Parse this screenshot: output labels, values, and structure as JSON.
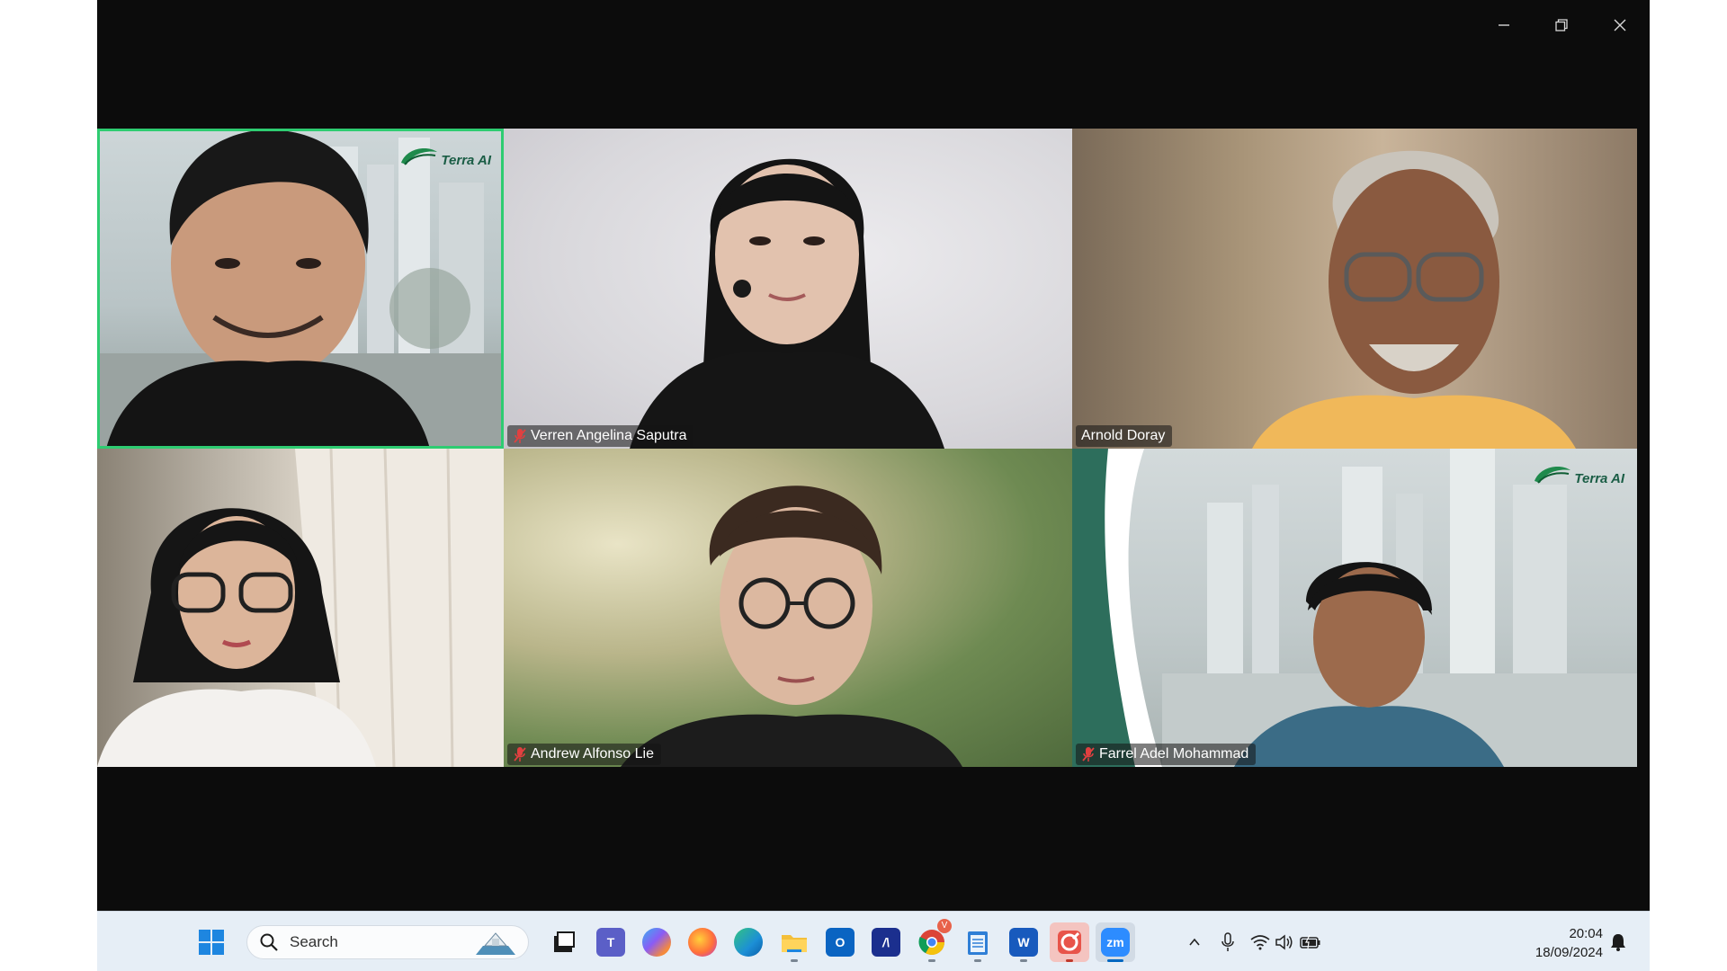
{
  "window": {
    "controls": {
      "minimize_icon": "minimize-icon",
      "restore_icon": "restore-icon",
      "close_icon": "close-icon"
    }
  },
  "gallery": {
    "tiles": [
      {
        "id": "tile-1",
        "name": "",
        "muted": false,
        "active_speaker": true,
        "background": "Terra AI virtual background",
        "logo_text": "Terra AI"
      },
      {
        "id": "tile-2",
        "name": "Verren Angelina Saputra",
        "muted": true,
        "active_speaker": false
      },
      {
        "id": "tile-3",
        "name": "Arnold Doray",
        "muted": false,
        "active_speaker": false
      },
      {
        "id": "tile-4",
        "name": "",
        "muted": false,
        "active_speaker": false
      },
      {
        "id": "tile-5",
        "name": "Andrew Alfonso Lie",
        "muted": true,
        "active_speaker": false
      },
      {
        "id": "tile-6",
        "name": "Farrel Adel Mohammad",
        "muted": true,
        "active_speaker": false,
        "logo_text": "Terra AI"
      }
    ],
    "accent_active": "#2ecc71",
    "mute_color": "#e04040"
  },
  "taskbar": {
    "search_placeholder": "Search",
    "apps": [
      {
        "name": "start-icon"
      },
      {
        "name": "task-view-icon"
      },
      {
        "name": "teams-icon"
      },
      {
        "name": "copilot-icon"
      },
      {
        "name": "firefox-icon"
      },
      {
        "name": "edge-icon"
      },
      {
        "name": "file-explorer-icon"
      },
      {
        "name": "outlook-icon"
      },
      {
        "name": "app-icon"
      },
      {
        "name": "chrome-icon",
        "badge": "V"
      },
      {
        "name": "notepad-icon"
      },
      {
        "name": "word-icon",
        "label": "W"
      },
      {
        "name": "snipping-tool-icon"
      },
      {
        "name": "zoom-icon",
        "label": "zm"
      }
    ],
    "tray": {
      "time": "20:04",
      "date": "18/09/2024"
    }
  }
}
